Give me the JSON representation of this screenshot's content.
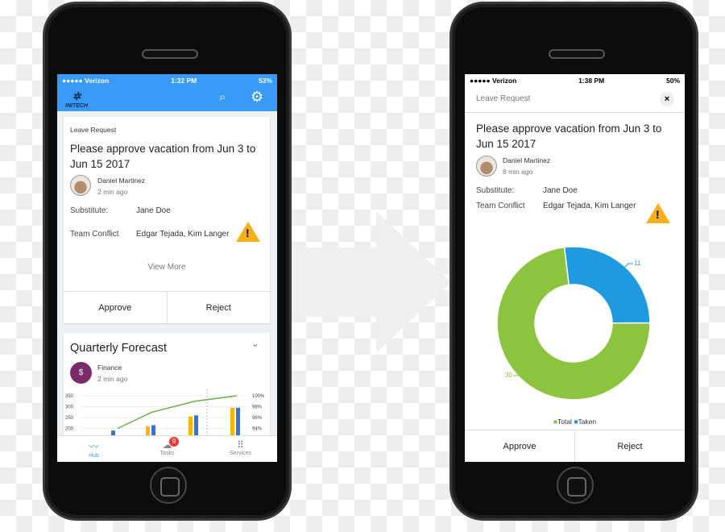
{
  "left": {
    "status": {
      "carrier": "●●●●● Verizon",
      "time": "1:32 PM",
      "battery": "53%"
    },
    "header": {
      "logo": "INITECH",
      "color": "#3a9af7"
    },
    "request": {
      "type": "Leave Request",
      "title": "Please approve vacation from Jun 3 to Jun 15 2017",
      "author": "Daniel Martinez",
      "time": "2 min ago",
      "substitute_label": "Substitute:",
      "substitute": "Jane Doe",
      "conflict_label": "Team Conflict",
      "conflict": "Edgar Tejada, Kim Langer",
      "view_more": "View More",
      "approve": "Approve",
      "reject": "Reject"
    },
    "forecast": {
      "title": "Quarterly Forecast",
      "source": "Finance",
      "time": "2 min ago",
      "chart_data": {
        "type": "bar",
        "y_ticks": [
          "350",
          "300",
          "250",
          "200"
        ],
        "y2_ticks": [
          "100%",
          "98%",
          "96%",
          "94%"
        ],
        "series": [
          {
            "color": "#f5b800",
            "values": [
              null,
              210,
              255,
              295
            ]
          },
          {
            "color": "#3f6fd1",
            "values": [
              190,
              215,
              260,
              295
            ]
          },
          {
            "type": "line",
            "color": "#6ab04c",
            "values": [
              94,
              97,
              99,
              100
            ]
          }
        ]
      }
    },
    "tabs": [
      {
        "label": "Hub",
        "icon": "waveform-icon",
        "active": true
      },
      {
        "label": "Tasks",
        "icon": "tasks-icon",
        "badge": "9"
      },
      {
        "label": "Services",
        "icon": "grid-icon"
      }
    ]
  },
  "right": {
    "status": {
      "carrier": "●●●●● Verizon",
      "time": "1:38 PM",
      "battery": "50%"
    },
    "header": {
      "title": "Leave Request"
    },
    "request": {
      "title": "Please approve vacation from Jun 3 to Jun 15 2017",
      "author": "Daniel Martinez",
      "time": "8 min ago",
      "substitute_label": "Substitute:",
      "substitute": "Jane Doe",
      "conflict_label": "Team Conflict",
      "conflict": "Edgar Tejada, Kim Langer",
      "approve": "Approve",
      "reject": "Reject"
    },
    "chart_data": {
      "type": "pie",
      "donut": true,
      "slices": [
        {
          "name": "Total",
          "value": 30,
          "label": "30",
          "color": "#8cc43f"
        },
        {
          "name": "Taken",
          "value": 11,
          "label": "11",
          "color": "#1e9be0"
        }
      ],
      "legend": "bottom"
    }
  }
}
